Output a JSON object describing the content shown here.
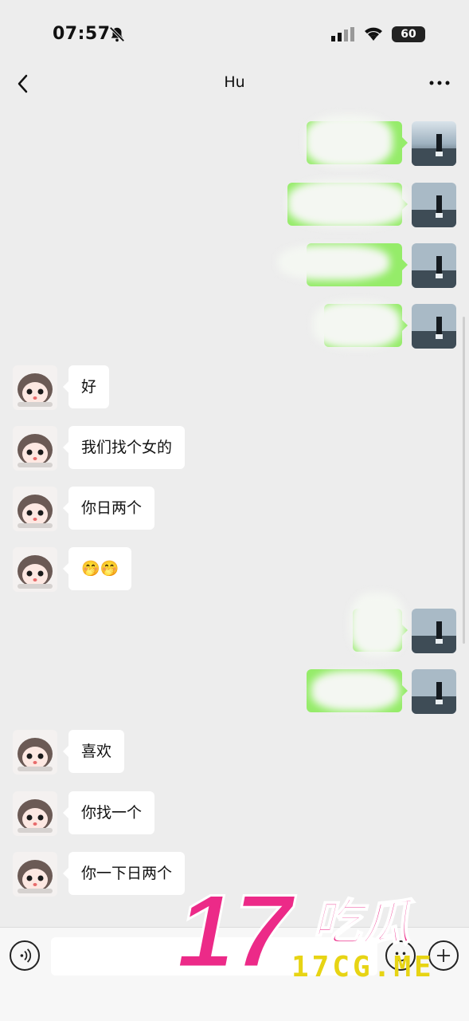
{
  "status_bar": {
    "time": "07:57",
    "battery": "60"
  },
  "header": {
    "title": "Hu"
  },
  "messages": [
    {
      "side": "out",
      "text": ""
    },
    {
      "side": "out",
      "text": ""
    },
    {
      "side": "out",
      "text": ""
    },
    {
      "side": "out",
      "text": ""
    },
    {
      "side": "in",
      "text": "好"
    },
    {
      "side": "in",
      "text": "我们找个女的"
    },
    {
      "side": "in",
      "text": "你日两个"
    },
    {
      "side": "in",
      "text": "🤭🤭"
    },
    {
      "side": "out",
      "text": ""
    },
    {
      "side": "out",
      "text": ""
    },
    {
      "side": "in",
      "text": "喜欢"
    },
    {
      "side": "in",
      "text": "你找一个"
    },
    {
      "side": "in",
      "text": "你一下日两个"
    }
  ],
  "colors": {
    "background": "#ededed",
    "incoming_bubble": "#ffffff",
    "outgoing_bubble": "#95ec69"
  },
  "icons": [
    "back-icon",
    "more-icon",
    "voice-icon",
    "emoji-icon",
    "plus-icon",
    "bell-slash-icon",
    "signal-icon",
    "wifi-icon"
  ],
  "watermark": {
    "logo_text": "17吃瓜",
    "url": "17CG.ME"
  }
}
